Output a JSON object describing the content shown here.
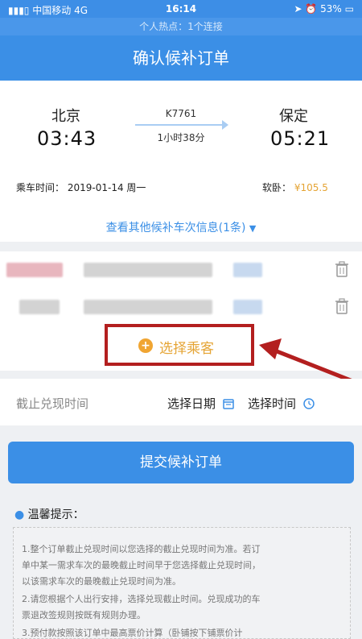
{
  "status_bar": {
    "carrier": "中国移动",
    "network": "4G",
    "time": "16:14",
    "battery": "53%"
  },
  "hotspot": {
    "text": "个人热点：1个连接"
  },
  "nav": {
    "title": "确认候补订单"
  },
  "train": {
    "from_station": "北京",
    "to_station": "保定",
    "depart_time": "03:43",
    "arrive_time": "05:21",
    "train_no": "K7761",
    "duration": "1小时38分",
    "ride_date_label": "乘车时间：",
    "ride_date": "2019-01-14 周一",
    "seat_type": "软卧：",
    "price": "¥105.5",
    "more_link": "查看其他候补车次信息(1条)"
  },
  "passengers": {
    "select_label": "选择乘客"
  },
  "deadline": {
    "label": "截止兑现时间",
    "date_label": "选择日期",
    "time_label": "选择时间"
  },
  "submit": {
    "label": "提交候补订单"
  },
  "tips": {
    "title": "温馨提示：",
    "lines": [
      "1.整个订单截止兑现时间以您选择的截止兑现时间为准。若订",
      "单中某一需求车次的最晚截止时间早于您选择截止兑现时间，",
      "以该需求车次的最晚截止兑现时间为准。",
      "2.请您根据个人出行安排，选择兑现截止时间。兑现成功的车",
      "票退改签规则按既有规则办理。",
      "3.预付款按照该订单中最高票价计算（卧铺按下铺票价计"
    ]
  },
  "colors": {
    "primary": "#3b8fe6",
    "accent": "#e5a434",
    "highlight_border": "#b31f1f"
  }
}
